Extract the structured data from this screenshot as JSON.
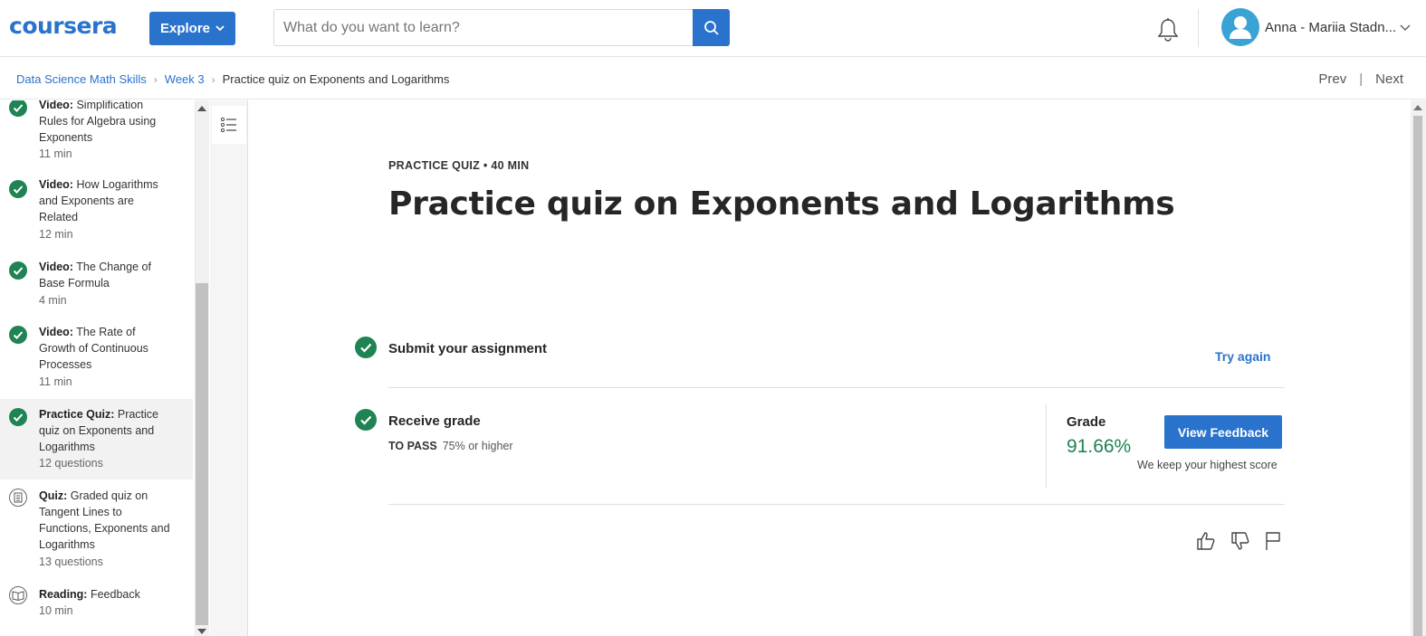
{
  "header": {
    "logo_text": "coursera",
    "explore_label": "Explore",
    "search_placeholder": "What do you want to learn?",
    "user_name": "Anna - Mariia Stadn..."
  },
  "breadcrumb": {
    "items": [
      "Data Science Math Skills",
      "Week 3",
      "Practice quiz on Exponents and Logarithms"
    ],
    "prev_label": "Prev",
    "next_label": "Next"
  },
  "sidebar": {
    "items": [
      {
        "type": "Video:",
        "title": "Simplification Rules for Algebra using Exponents",
        "meta": "11 min",
        "status": "done"
      },
      {
        "type": "Video:",
        "title": "How Logarithms and Exponents are Related",
        "meta": "12 min",
        "status": "done"
      },
      {
        "type": "Video:",
        "title": "The Change of Base Formula",
        "meta": "4 min",
        "status": "done"
      },
      {
        "type": "Video:",
        "title": "The Rate of Growth of Continuous Processes",
        "meta": "11 min",
        "status": "done"
      },
      {
        "type": "Practice Quiz:",
        "title": "Practice quiz on Exponents and Logarithms",
        "meta": "12 questions",
        "status": "done"
      },
      {
        "type": "Quiz:",
        "title": "Graded quiz on Tangent Lines to Functions, Exponents and Logarithms",
        "meta": "13 questions",
        "status": "quiz"
      },
      {
        "type": "Reading:",
        "title": "Feedback",
        "meta": "10 min",
        "status": "reading"
      }
    ]
  },
  "main": {
    "meta": "PRACTICE QUIZ • 40 MIN",
    "title": "Practice quiz on Exponents and Logarithms",
    "submit_label": "Submit your assignment",
    "try_again_label": "Try again",
    "receive_label": "Receive grade",
    "to_pass_label": "TO PASS",
    "to_pass_value": "75% or higher",
    "grade_label": "Grade",
    "grade_value": "91.66%",
    "view_feedback_label": "View Feedback",
    "keep_note": "We keep your highest score"
  },
  "colors": {
    "brand": "#2a73cc",
    "success": "#1f8354"
  }
}
